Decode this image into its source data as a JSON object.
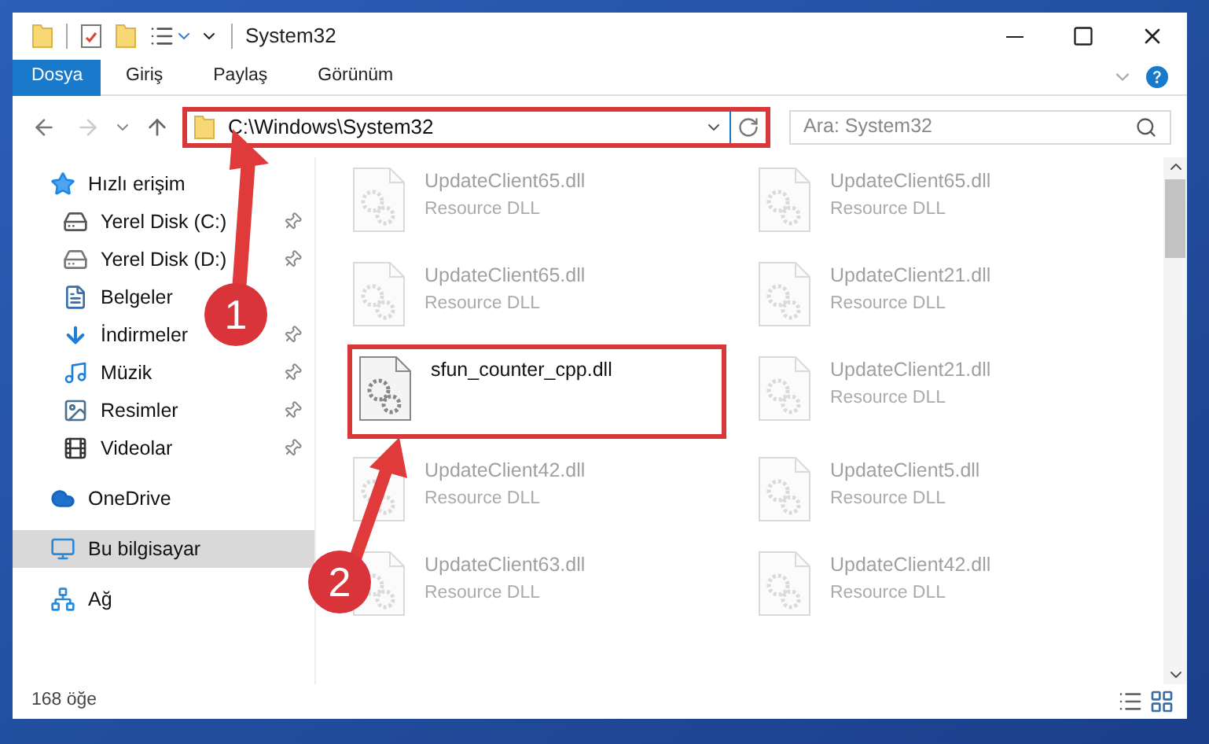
{
  "window": {
    "title": "System32"
  },
  "ribbon": {
    "tabs": [
      {
        "label": "Dosya",
        "selected": true
      },
      {
        "label": "Giriş",
        "selected": false
      },
      {
        "label": "Paylaş",
        "selected": false
      },
      {
        "label": "Görünüm",
        "selected": false
      }
    ]
  },
  "address": {
    "path": "C:\\Windows\\System32",
    "highlighted": true
  },
  "search": {
    "placeholder": "Ara: System32"
  },
  "sidebar": {
    "items": [
      {
        "label": "Hızlı erişim",
        "kind": "star",
        "selected": false,
        "children": [
          {
            "label": "Yerel Disk (C:)",
            "kind": "drive-win",
            "pinned": true
          },
          {
            "label": "Yerel Disk (D:)",
            "kind": "drive",
            "pinned": true
          },
          {
            "label": "Belgeler",
            "kind": "docs",
            "pinned": false
          },
          {
            "label": "İndirmeler",
            "kind": "download",
            "pinned": true
          },
          {
            "label": "Müzik",
            "kind": "music",
            "pinned": true
          },
          {
            "label": "Resimler",
            "kind": "pictures",
            "pinned": true
          },
          {
            "label": "Videolar",
            "kind": "videos",
            "pinned": true
          }
        ]
      },
      {
        "label": "OneDrive",
        "kind": "cloud",
        "selected": false
      },
      {
        "label": "Bu bilgisayar",
        "kind": "pc",
        "selected": true
      },
      {
        "label": "Ağ",
        "kind": "network",
        "selected": false
      }
    ]
  },
  "files": [
    {
      "name": "UpdateClient65.dll",
      "type": "Resource DLL",
      "dimmed": true,
      "highlighted": false
    },
    {
      "name": "UpdateClient65.dll",
      "type": "Resource DLL",
      "dimmed": true,
      "highlighted": false
    },
    {
      "name": "UpdateClient65.dll",
      "type": "Resource DLL",
      "dimmed": true,
      "highlighted": false
    },
    {
      "name": "UpdateClient21.dll",
      "type": "Resource DLL",
      "dimmed": true,
      "highlighted": false
    },
    {
      "name": "sfun_counter_cpp.dll",
      "dimmed": false,
      "highlighted": true
    },
    {
      "name": "UpdateClient21.dll",
      "type": "Resource DLL",
      "dimmed": true,
      "highlighted": false
    },
    {
      "name": "UpdateClient42.dll",
      "type": "Resource DLL",
      "dimmed": true,
      "highlighted": false
    },
    {
      "name": "UpdateClient5.dll",
      "type": "Resource DLL",
      "dimmed": true,
      "highlighted": false
    },
    {
      "name": "UpdateClient63.dll",
      "type": "Resource DLL",
      "dimmed": true,
      "highlighted": false
    },
    {
      "name": "UpdateClient42.dll",
      "type": "Resource DLL",
      "dimmed": true,
      "highlighted": false
    }
  ],
  "status_bar": {
    "item_count": "168 öğe"
  },
  "annotations": [
    {
      "label": "1"
    },
    {
      "label": "2"
    }
  ]
}
